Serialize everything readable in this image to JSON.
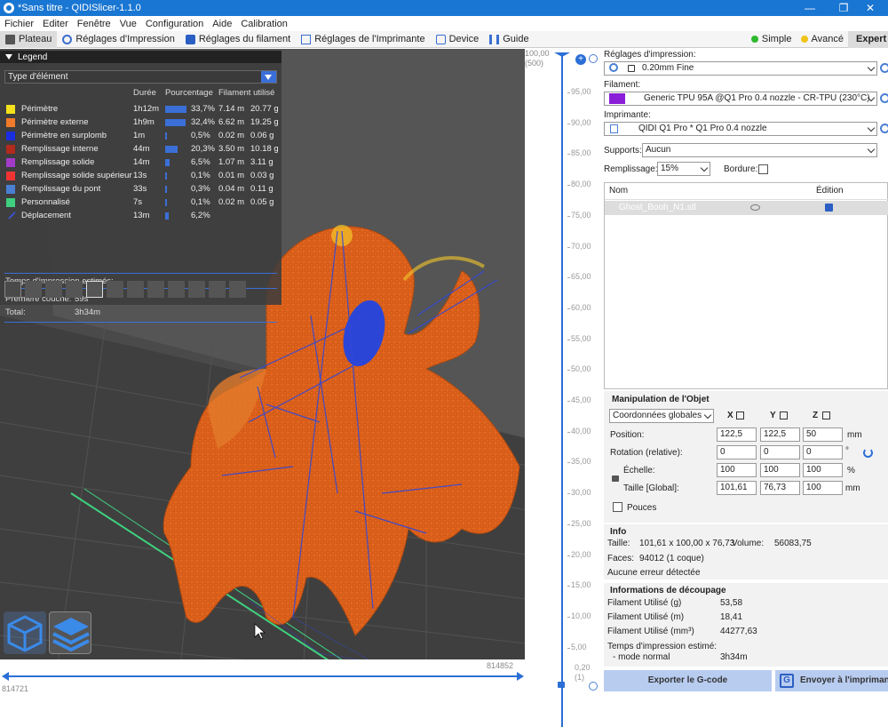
{
  "window": {
    "title": "*Sans titre - QIDISlicer-1.1.0",
    "minimize": "—",
    "maximize": "❐",
    "close": "✕"
  },
  "menu": [
    "Fichier",
    "Editer",
    "Fenêtre",
    "Vue",
    "Configuration",
    "Aide",
    "Calibration"
  ],
  "tabs": [
    {
      "label": "Plateau",
      "active": true
    },
    {
      "label": "Réglages d'Impression"
    },
    {
      "label": "Réglages du filament"
    },
    {
      "label": "Réglages de l'Imprimante"
    },
    {
      "label": "Device"
    },
    {
      "label": "Guide"
    }
  ],
  "modes": [
    {
      "label": "Simple",
      "color": "#2eb82e"
    },
    {
      "label": "Avancé",
      "color": "#f0c419"
    },
    {
      "label": "Expert",
      "color": "#e02020"
    }
  ],
  "legend": {
    "title": "Legend",
    "type_select": "Type d'élément",
    "columns": {
      "duration": "Durée",
      "percent": "Pourcentage",
      "filament": "Filament utilisé"
    },
    "rows": [
      {
        "name": "Périmètre",
        "color": "#f3e21b",
        "time": "1h12m",
        "pct": "33,7%",
        "frac": 0.337,
        "len": "7.14 m",
        "weight": "20.77 g"
      },
      {
        "name": "Périmètre externe",
        "color": "#f07b2a",
        "time": "1h9m",
        "pct": "32,4%",
        "frac": 0.324,
        "len": "6.62 m",
        "weight": "19.25 g"
      },
      {
        "name": "Périmètre en surplomb",
        "color": "#1a2ee0",
        "time": "1m",
        "pct": "0,5%",
        "frac": 0.005,
        "len": "0.02 m",
        "weight": "0.06 g"
      },
      {
        "name": "Remplissage interne",
        "color": "#b32a1e",
        "time": "44m",
        "pct": "20,3%",
        "frac": 0.203,
        "len": "3.50 m",
        "weight": "10.18 g"
      },
      {
        "name": "Remplissage solide",
        "color": "#a23bc8",
        "time": "14m",
        "pct": "6,5%",
        "frac": 0.065,
        "len": "1.07 m",
        "weight": "3.11 g"
      },
      {
        "name": "Remplissage solide supérieur",
        "color": "#f03434",
        "time": "13s",
        "pct": "0,1%",
        "frac": 0.001,
        "len": "0.01 m",
        "weight": "0.03 g"
      },
      {
        "name": "Remplissage du pont",
        "color": "#4a7fd4",
        "time": "33s",
        "pct": "0,3%",
        "frac": 0.003,
        "len": "0.04 m",
        "weight": "0.11 g"
      },
      {
        "name": "Personnalisé",
        "color": "#3fcf7f",
        "time": "7s",
        "pct": "0,1%",
        "frac": 0.001,
        "len": "0.02 m",
        "weight": "0.05 g"
      },
      {
        "name": "Déplacement",
        "color": "#3b52c8",
        "time": "13m",
        "pct": "6,2%",
        "frac": 0.062,
        "len": "",
        "weight": ""
      }
    ],
    "est_title": "Temps d'impression estimés:",
    "first_layer_label": "Première couche:",
    "first_layer_value": "59s",
    "total_label": "Total:",
    "total_value": "3h34m"
  },
  "hslider": {
    "left": "814721",
    "right": "814852"
  },
  "vslider": {
    "top": "100,00",
    "top_sub": "(500)",
    "bottom": "0,20",
    "bottom_sub": "(1)",
    "ticks": [
      "95,00",
      "90,00",
      "85,00",
      "80,00",
      "75,00",
      "70,00",
      "65,00",
      "60,00",
      "55,00",
      "50,00",
      "45,00",
      "40,00",
      "35,00",
      "30,00",
      "25,00",
      "20,00",
      "15,00",
      "10,00",
      "5,00"
    ]
  },
  "panel": {
    "print_settings_label": "Réglages d'impression:",
    "print_profile": "0.20mm Fine",
    "filament_label": "Filament:",
    "filament_profile": "Generic TPU 95A @Q1 Pro 0.4 nozzle - CR-TPU (230°C)",
    "filament_color": "#8a1ed8",
    "printer_label": "Imprimante:",
    "printer_profile": "QIDI Q1 Pro * Q1 Pro 0.4 nozzle",
    "supports_label": "Supports:",
    "supports_value": "Aucun",
    "infill_label": "Remplissage:",
    "infill_value": "15%",
    "brim_label": "Bordure:",
    "list_col_name": "Nom",
    "list_col_edit": "Édition",
    "object_name": "Ghost_Booh_N1.stl",
    "manip_title": "Manipulation de l'Objet",
    "coord_select": "Coordonnées globales",
    "axis_x": "X",
    "axis_y": "Y",
    "axis_z": "Z",
    "position_label": "Position:",
    "pos": [
      "122,5",
      "122,5",
      "50"
    ],
    "pos_unit": "mm",
    "rotation_label": "Rotation (relative):",
    "rot": [
      "0",
      "0",
      "0"
    ],
    "rot_unit": "°",
    "scale_label": "Échelle:",
    "scale": [
      "100",
      "100",
      "100"
    ],
    "scale_unit": "%",
    "size_label": "Taille [Global]:",
    "size": [
      "101,61",
      "76,73",
      "100"
    ],
    "size_unit": "mm",
    "inches_label": "Pouces",
    "info_title": "Info",
    "size_info_label": "Taille:",
    "size_info_value": "101,61 x 100,00 x 76,73",
    "volume_label": "Volume:",
    "volume_value": "56083,75",
    "faces_label": "Faces:",
    "faces_value": "94012 (1 coque)",
    "errors": "Aucune erreur détectée",
    "slice_title": "Informations de découpage",
    "fil_g_label": "Filament Utilisé (g)",
    "fil_g_value": "53,58",
    "fil_m_label": "Filament Utilisé (m)",
    "fil_m_value": "18,41",
    "fil_mm3_label": "Filament Utilisé (mm³)",
    "fil_mm3_value": "44277,63",
    "time_label": "Temps d'impression estimé:",
    "mode_label": "- mode normal",
    "mode_value": "3h34m",
    "export_button": "Exporter le G-code",
    "send_button": "Envoyer à l'imprimante"
  }
}
